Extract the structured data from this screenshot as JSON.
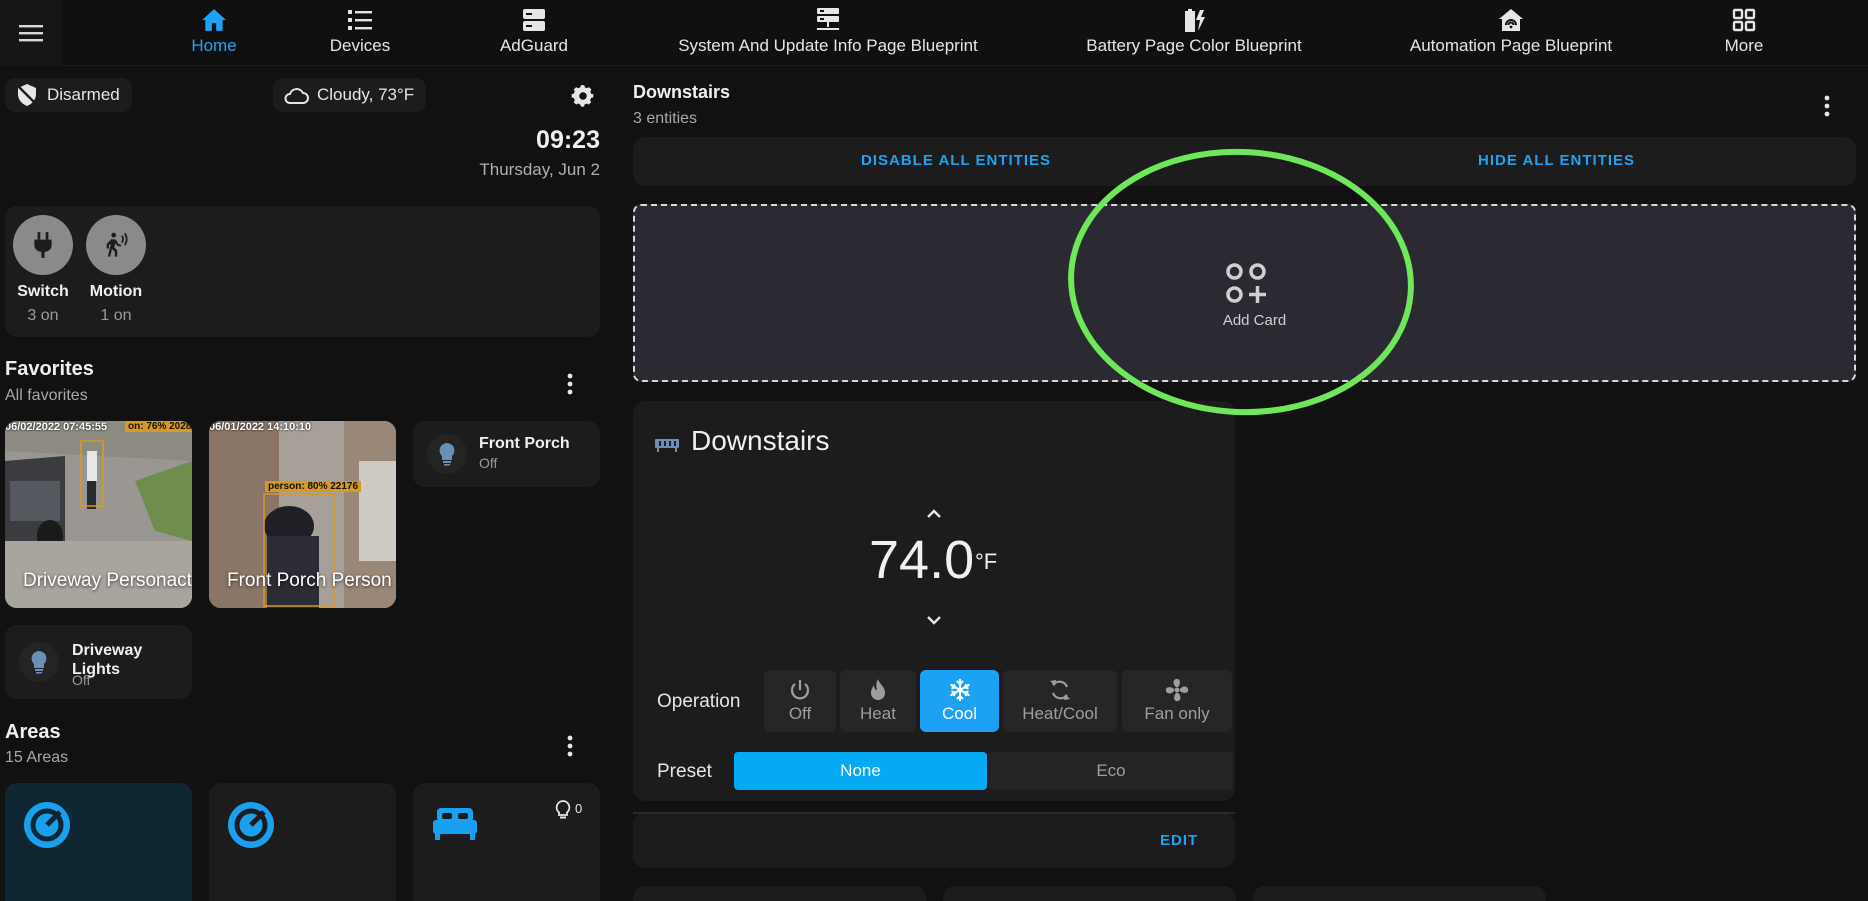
{
  "nav": {
    "tabs": [
      {
        "label": "Home",
        "icon": "home-icon"
      },
      {
        "label": "Devices",
        "icon": "list-icon"
      },
      {
        "label": "AdGuard",
        "icon": "server-icon"
      },
      {
        "label": "System And Update Info Page Blueprint",
        "icon": "server-network-icon"
      },
      {
        "label": "Battery Page Color Blueprint",
        "icon": "battery-charging-icon"
      },
      {
        "label": "Automation Page Blueprint",
        "icon": "home-automation-icon"
      },
      {
        "label": "More",
        "icon": "grid-icon"
      }
    ],
    "accent_color": "#1fa2f3"
  },
  "header": {
    "alarm_label": "Disarmed",
    "weather_label": "Cloudy, 73°F",
    "time": "09:23",
    "date": "Thursday, Jun 2"
  },
  "badges": [
    {
      "name": "Switch",
      "state": "3 on"
    },
    {
      "name": "Motion",
      "state": "1 on"
    }
  ],
  "favorites": {
    "title": "Favorites",
    "subtitle": "All favorites",
    "cameras": [
      {
        "label": "Driveway Personact",
        "timestamp": "06/02/2022 07:45:55",
        "detection": "on: 76% 2028"
      },
      {
        "label": "Front Porch Person",
        "timestamp": "06/01/2022 14:10:10",
        "detection": "person: 80% 22176"
      }
    ],
    "tiles": [
      {
        "name": "Front Porch",
        "state": "Off"
      },
      {
        "name": "Driveway Lights",
        "state": "Off"
      }
    ]
  },
  "areas": {
    "title": "Areas",
    "subtitle": "15 Areas",
    "light_count": "0"
  },
  "editor": {
    "title": "Downstairs",
    "subtitle": "3 entities",
    "disable_all": "DISABLE ALL ENTITIES",
    "hide_all": "HIDE ALL ENTITIES",
    "add_card": "Add Card"
  },
  "thermostat": {
    "name": "Downstairs",
    "temperature": "74.0",
    "unit": "°F",
    "operation_label": "Operation",
    "modes": [
      {
        "label": "Off",
        "icon": "power-icon",
        "active": false
      },
      {
        "label": "Heat",
        "icon": "fire-icon",
        "active": false
      },
      {
        "label": "Cool",
        "icon": "snowflake-icon",
        "active": true
      },
      {
        "label": "Heat/Cool",
        "icon": "sync-icon",
        "active": false
      },
      {
        "label": "Fan only",
        "icon": "fan-icon",
        "active": false
      }
    ],
    "preset_label": "Preset",
    "presets": [
      {
        "label": "None",
        "active": true
      },
      {
        "label": "Eco",
        "active": false
      }
    ],
    "edit_label": "EDIT",
    "active_color": "#1da1f2"
  },
  "annotation": {
    "color": "#6ee85a"
  }
}
